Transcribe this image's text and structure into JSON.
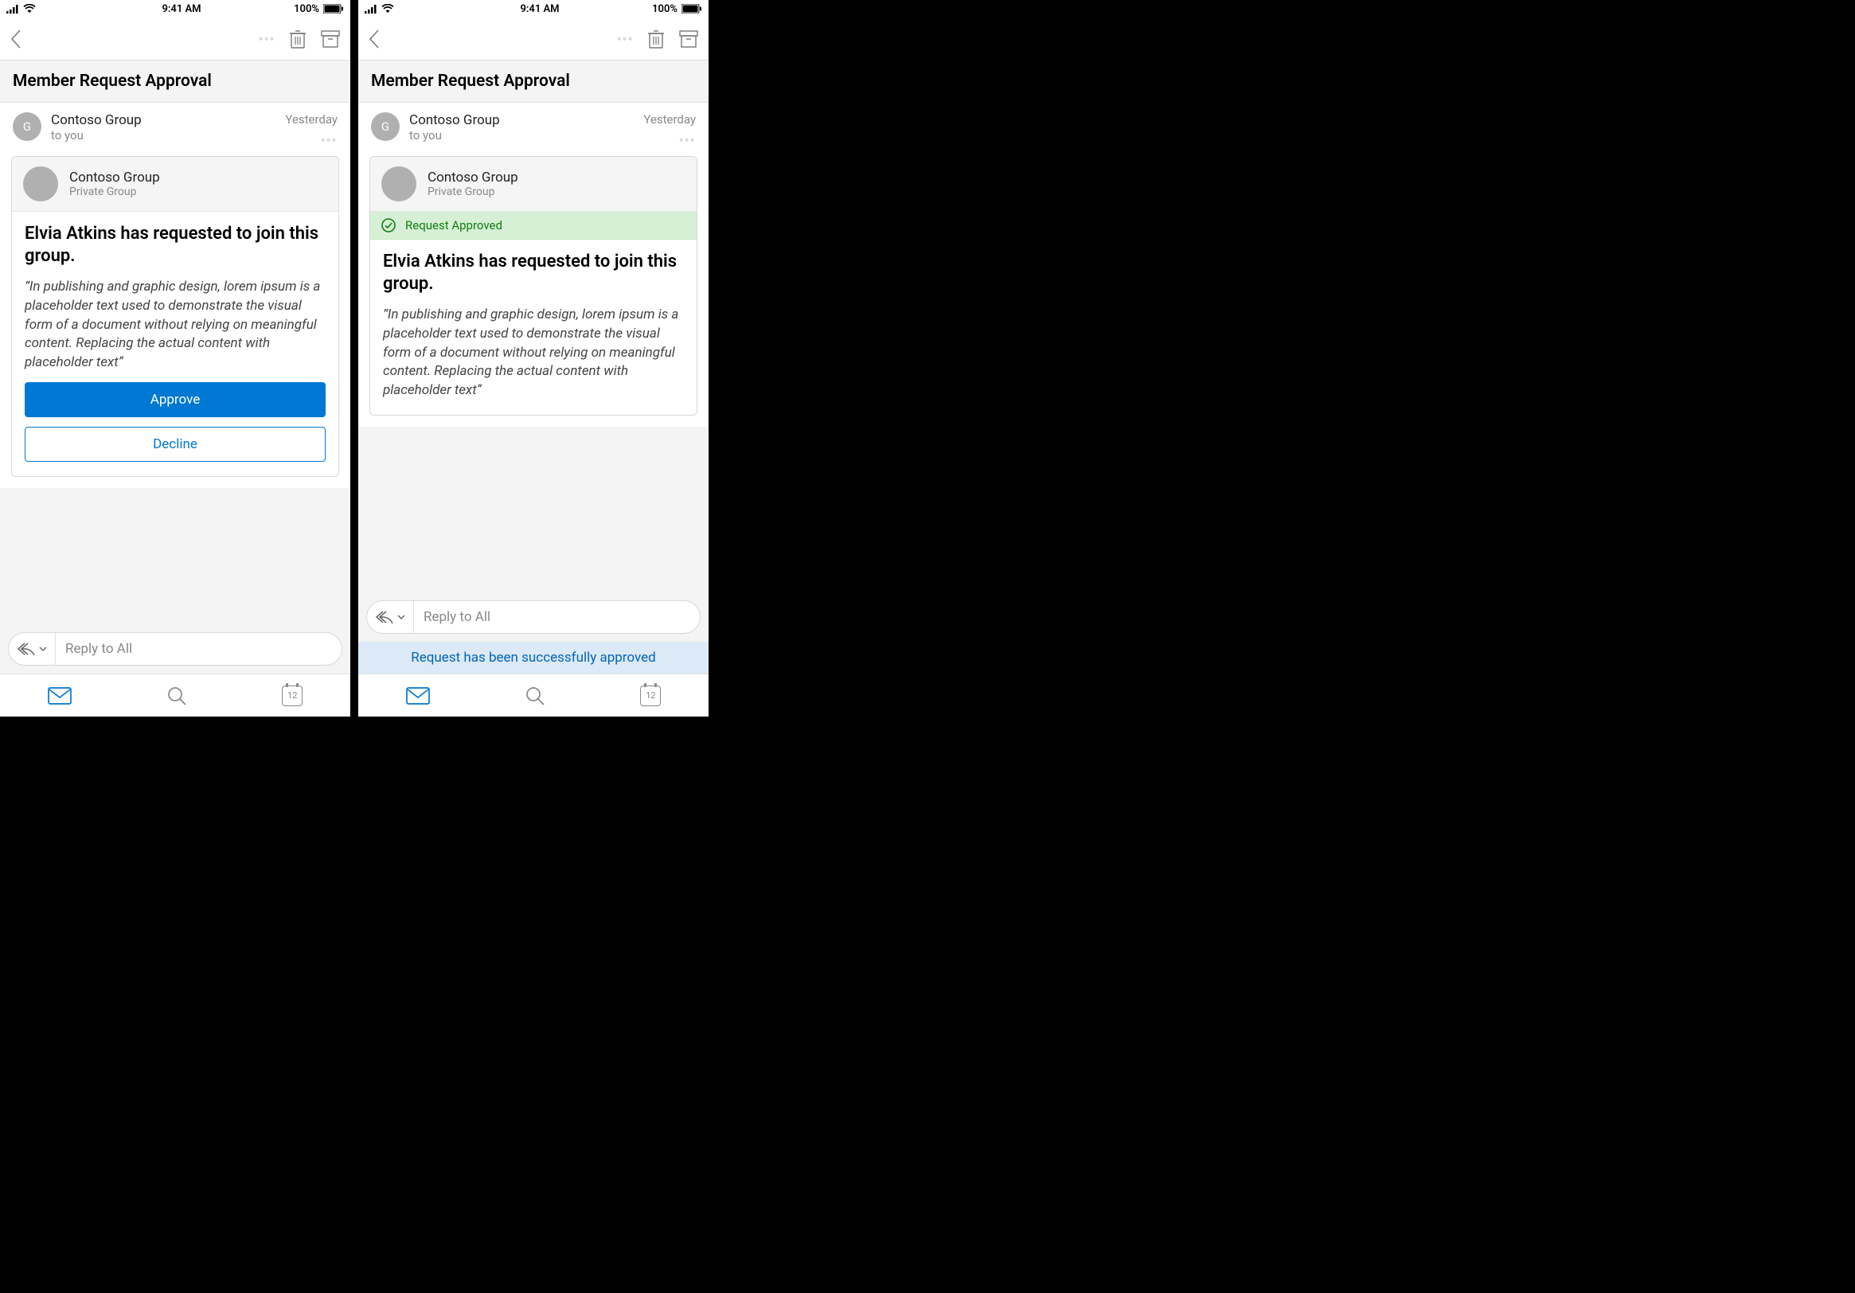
{
  "statusbar": {
    "time": "9:41 AM",
    "battery": "100%"
  },
  "navbar": {
    "title": "Member Request Approval"
  },
  "sender": {
    "avatar_letter": "G",
    "name": "Contoso Group",
    "to": "to you",
    "date": "Yesterday"
  },
  "card": {
    "group_name": "Contoso Group",
    "group_type": "Private Group",
    "approved_banner": "Request Approved",
    "request_text": "Elvia Atkins has requested to join this group.",
    "quote_text": "“In publishing and graphic design, lorem ipsum is a placeholder text used to demonstrate the visual form of a document without relying on meaningful content. Replacing the actual content with placeholder text”",
    "approve_label": "Approve",
    "decline_label": "Decline"
  },
  "reply": {
    "placeholder": "Reply to All"
  },
  "toast": {
    "message": "Request has been successfully approved"
  },
  "tabbar": {
    "calendar_day": "12"
  }
}
